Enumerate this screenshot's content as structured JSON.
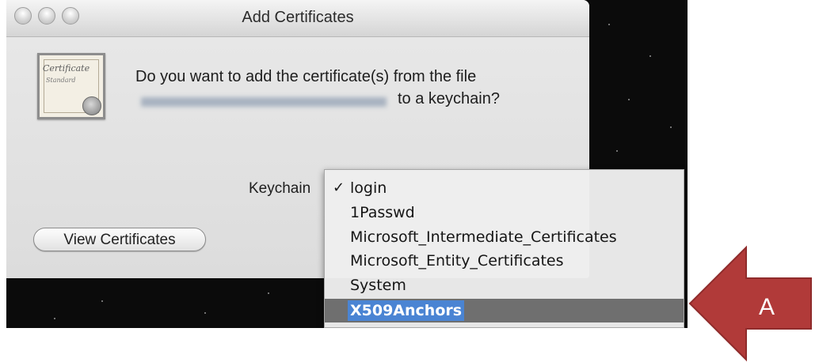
{
  "window": {
    "title": "Add Certificates"
  },
  "icon": {
    "name": "certificate-icon",
    "line1": "Certificate",
    "line2": "Standard"
  },
  "dialog": {
    "message_line1": "Do you want to add the certificate(s) from the file",
    "message_line2": "to a keychain?",
    "keychain_label": "Keychain",
    "view_button": "View Certificates"
  },
  "keychain_menu": {
    "items": [
      {
        "label": "login",
        "checked": true
      },
      {
        "label": "1Passwd"
      },
      {
        "label": "Microsoft_Intermediate_Certificates"
      },
      {
        "label": "Microsoft_Entity_Certificates"
      },
      {
        "label": "System"
      },
      {
        "label": "X509Anchors",
        "highlighted": true
      }
    ],
    "check_mark": "✓"
  },
  "callout": {
    "label": "A",
    "color": "#b13a39",
    "border": "#8f2b2b"
  },
  "colors": {
    "highlight": "#4a84d3",
    "highlight_row": "#6f6f6f"
  }
}
